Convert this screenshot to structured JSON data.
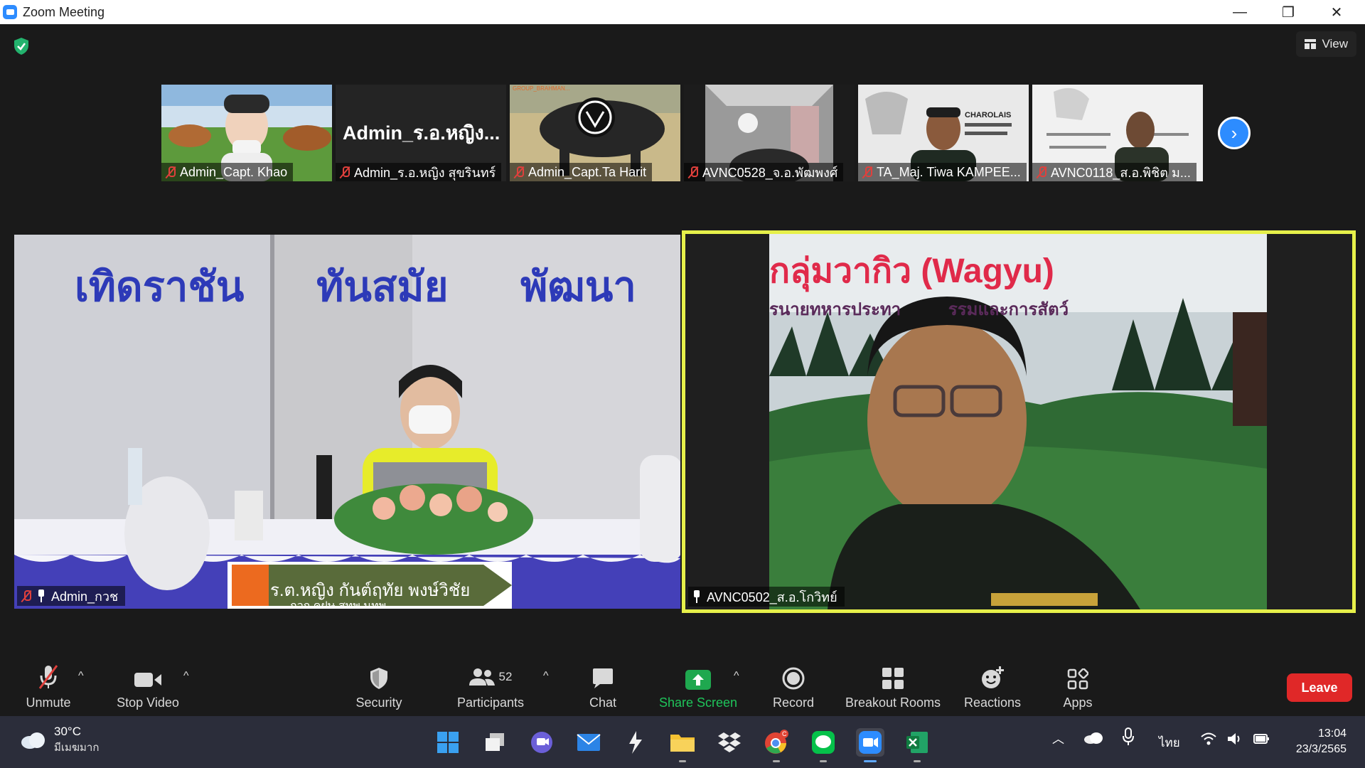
{
  "window": {
    "title": "Zoom Meeting",
    "minimize": "—",
    "maximize": "❐",
    "close": "✕"
  },
  "meeting": {
    "view_label": "View"
  },
  "thumbnails": [
    {
      "name": "Admin_Capt. Khao"
    },
    {
      "name": "Admin_ร.อ.หญิง สุขรินทร์",
      "big_text": "Admin_ร.อ.หญิง..."
    },
    {
      "name": "Admin_Capt.Ta Harit"
    },
    {
      "name": "AVNC0528_จ.อ.พัฒพงศ์"
    },
    {
      "name": "TA_Maj. Tiwa KAMPEE..."
    },
    {
      "name": "AVNC0118_ส.อ.พิชิต ม..."
    }
  ],
  "main_tiles": {
    "left": {
      "name": "Admin_กวช",
      "banner_words": [
        "เทิดราชัน",
        "ทันสมัย",
        "พัฒนา"
      ],
      "nameplate_line1": "ร.ต.หญิง กันต์ฤทัย  พงษ์วิชัย",
      "nameplate_line2": "กวก.คฝษ.สทพ.นทพ."
    },
    "right": {
      "name": "AVNC0502_ส.อ.โกวิทย์",
      "slide_title": "กลุ่มวากิว (Wagyu)",
      "slide_sub": "รนายทหารประทา          รรมและการสัตว์"
    }
  },
  "thumb_texts": {
    "charolais": "CHAROLAIS",
    "group_brahman": "GROUP_BRAHMAN..."
  },
  "toolbar": {
    "unmute": "Unmute",
    "stop_video": "Stop Video",
    "security": "Security",
    "participants": "Participants",
    "participants_count": "52",
    "chat": "Chat",
    "share_screen": "Share Screen",
    "record": "Record",
    "breakout_rooms": "Breakout Rooms",
    "reactions": "Reactions",
    "apps": "Apps",
    "leave": "Leave"
  },
  "taskbar": {
    "temp": "30°C",
    "weather_desc": "มีเมฆมาก",
    "lang": "ไทย",
    "time": "13:04",
    "date": "23/3/2565",
    "chrome_badge": "C"
  },
  "colors": {
    "accent": "#2d8cff",
    "active_speaker": "#e6f04a",
    "share": "#1fa84f",
    "leave": "#e02828"
  }
}
